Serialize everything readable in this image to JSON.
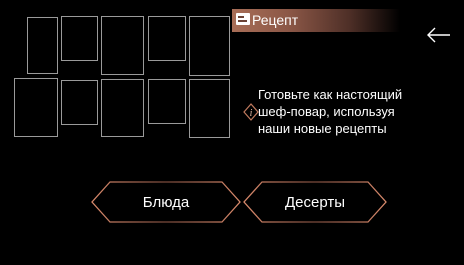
{
  "header": {
    "title": "Рецепт"
  },
  "info": {
    "lines": [
      "Готовьте как настоящий",
      "шеф-повар, используя",
      "наши новые рецепты"
    ]
  },
  "buttons": {
    "dishes": "Блюда",
    "desserts": "Десерты"
  },
  "icons": {
    "back": "arrow-left-icon",
    "header": "recipe-book-icon",
    "info": "info-icon"
  },
  "colors": {
    "accent": "#a86e57",
    "tile_border": "#9a9a9a",
    "background": "#000000"
  }
}
